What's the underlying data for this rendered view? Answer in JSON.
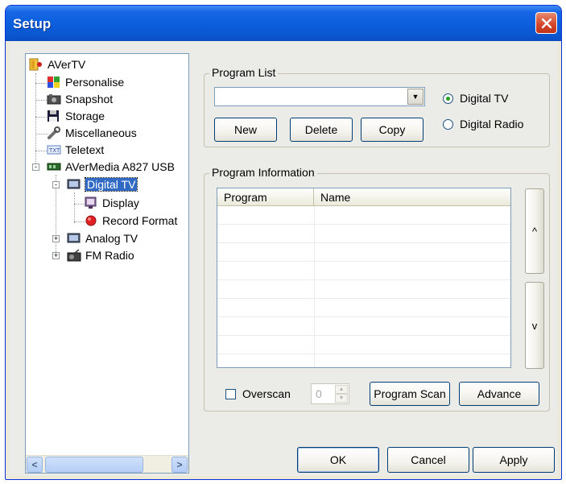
{
  "window": {
    "title": "Setup",
    "colors": {
      "title_bar": "#0a5ddb",
      "close_button": "#d3442a",
      "selection": "#316ac5"
    }
  },
  "tree": {
    "items": [
      {
        "label": "AVerTV",
        "icon": "avertv-folder-icon"
      },
      {
        "label": "Personalise",
        "icon": "personalise-icon"
      },
      {
        "label": "Snapshot",
        "icon": "camera-icon"
      },
      {
        "label": "Storage",
        "icon": "floppy-disk-icon"
      },
      {
        "label": "Miscellaneous",
        "icon": "wrench-icon"
      },
      {
        "label": "Teletext",
        "icon": "teletext-icon"
      },
      {
        "label": "AVerMedia A827 USB",
        "icon": "usb-device-icon"
      },
      {
        "label": "Digital TV",
        "icon": "tv-icon"
      },
      {
        "label": "Display",
        "icon": "monitor-icon"
      },
      {
        "label": "Record Format",
        "icon": "record-icon"
      },
      {
        "label": "Analog TV",
        "icon": "tv-icon"
      },
      {
        "label": "FM Radio",
        "icon": "radio-icon"
      }
    ],
    "expanders": [
      "-",
      "-",
      "+",
      "+"
    ],
    "scroll_left": "<",
    "scroll_right": ">"
  },
  "program_list": {
    "legend": "Program List",
    "combo_value": "",
    "combo_arrow": "▼",
    "buttons": {
      "new": "New",
      "delete": "Delete",
      "copy": "Copy"
    },
    "radios": [
      {
        "label": "Digital TV",
        "checked": true
      },
      {
        "label": "Digital Radio",
        "checked": false
      }
    ]
  },
  "program_info": {
    "legend": "Program Information",
    "columns": [
      "Program",
      "Name"
    ],
    "rows": [],
    "scroll_up": "^",
    "scroll_down": "v",
    "overscan_label": "Overscan",
    "overscan_checked": false,
    "overscan_value": "0",
    "program_scan": "Program Scan",
    "advance": "Advance"
  },
  "footer": {
    "ok": "OK",
    "cancel": "Cancel",
    "apply": "Apply"
  }
}
